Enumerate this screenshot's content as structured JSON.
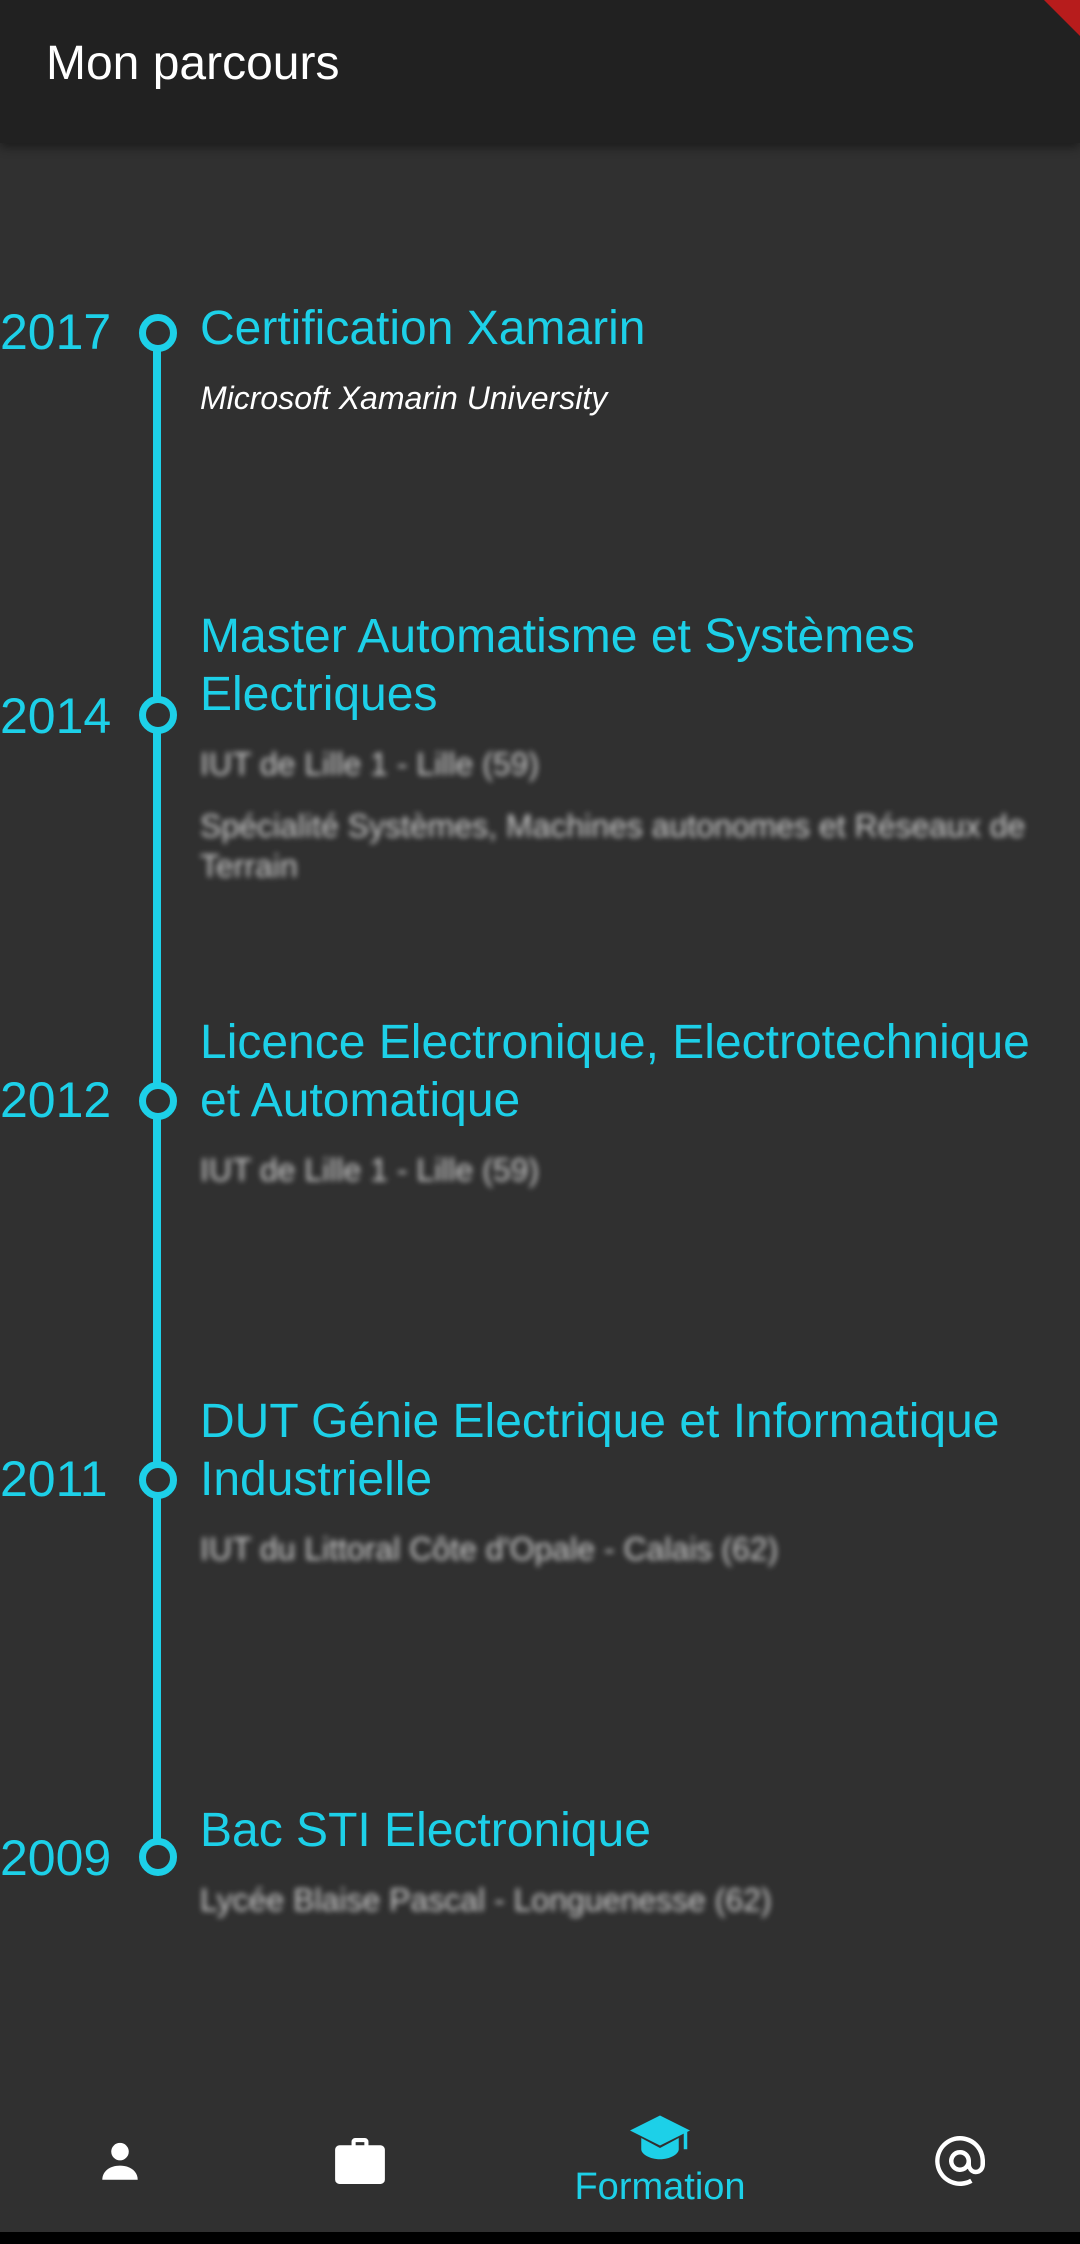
{
  "app_bar": {
    "title": "Mon parcours"
  },
  "timeline": [
    {
      "year": "2017",
      "title": "Certification Xamarin",
      "institution": "Microsoft Xamarin University"
    },
    {
      "year": "2014",
      "title": "Master Automatisme et Systèmes Electriques",
      "institution": "IUT de Lille 1 - Lille (59)",
      "detail": "Spécialité Systèmes, Machines autonomes et Réseaux de Terrain"
    },
    {
      "year": "2012",
      "title": "Licence Electronique, Electrotechnique et Automatique",
      "institution": "IUT de Lille 1 - Lille (59)"
    },
    {
      "year": "2011",
      "title": "DUT Génie Electrique et Informatique Industrielle",
      "institution": "IUT du Littoral Côte d'Opale - Calais (62)"
    },
    {
      "year": "2009",
      "title": "Bac STI Electronique",
      "institution": "Lycée Blaise Pascal - Longuenesse (62)"
    }
  ],
  "bottom_nav": {
    "items": [
      {
        "icon": "person-icon",
        "label": ""
      },
      {
        "icon": "briefcase-icon",
        "label": ""
      },
      {
        "icon": "graduation-cap-icon",
        "label": "Formation",
        "active": true
      },
      {
        "icon": "at-sign-icon",
        "label": ""
      }
    ]
  },
  "colors": {
    "accent": "#1dd0e8",
    "background": "#303030",
    "app_bar": "#212121"
  }
}
